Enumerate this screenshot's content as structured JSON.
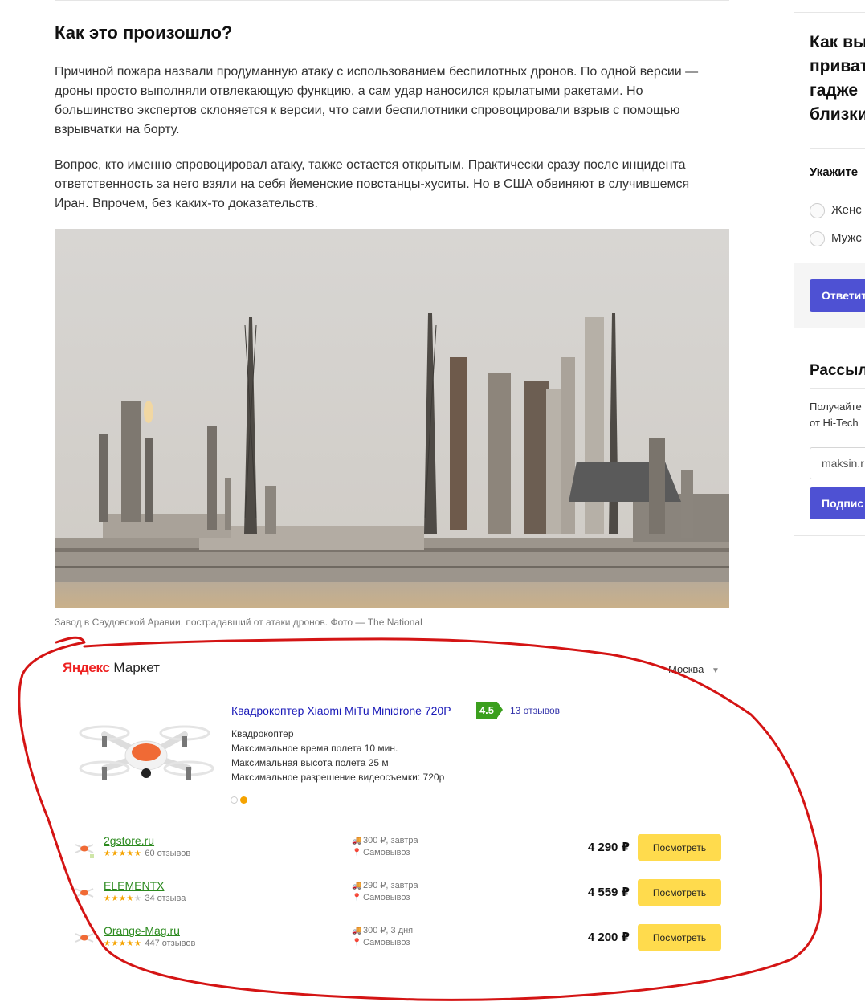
{
  "article": {
    "heading": "Как это произошло?",
    "paragraphs": [
      "Причиной пожара назвали продуманную атаку с использованием беспилотных дронов. По одной версии — дроны просто выполняли отвлекающую функцию, а сам удар наносился крылатыми ракетами. Но большинство экспертов склоняется к версии, что сами беспилотники спровоцировали взрыв с помощью взрывчатки на борту.",
      "Вопрос, кто именно спровоцировал атаку, также остается открытым. Практически сразу после инцидента ответственность за него взяли на себя йеменские повстанцы-хуситы. Но в США обвиняют в случившемся Иран. Впрочем, без каких-то доказательств."
    ],
    "photo_caption": "Завод в Саудовской Аравии, пострадавший от атаки дронов. Фото — The National"
  },
  "market": {
    "logo_yandex": "Яндекс",
    "logo_market": "Маркет",
    "region": "Москва",
    "product": {
      "title": "Квадрокоптер Xiaomi MiTu Minidrone 720P",
      "rating": "4.5",
      "reviews": "13 отзывов",
      "specs": [
        "Квадрокоптер",
        "Максимальное время полета 10 мин.",
        "Максимальная высота полета 25 м",
        "Максимальное разрешение видеосъемки: 720р"
      ]
    },
    "offers": [
      {
        "shop": "2gstore.ru",
        "stars": 5,
        "reviews": "60 отзывов",
        "delivery": "300 ₽, завтра",
        "pickup": "Самовывоз",
        "price": "4 290 ₽",
        "button": "Посмотреть"
      },
      {
        "shop": "ELEMENTX",
        "stars": 4,
        "reviews": "34 отзыва",
        "delivery": "290 ₽, завтра",
        "pickup": "Самовывоз",
        "price": "4 559 ₽",
        "button": "Посмотреть"
      },
      {
        "shop": "Orange-Mag.ru",
        "stars": 5,
        "reviews": "447 отзывов",
        "delivery": "300 ₽, 3 дня",
        "pickup": "Самовывоз",
        "price": "4 200 ₽",
        "button": "Посмотреть"
      }
    ]
  },
  "sidebar": {
    "poll": {
      "question_lines": [
        "Как вы",
        "приват",
        "гадже",
        "близки"
      ],
      "prompt": "Укажите",
      "options": [
        "Женс",
        "Мужс"
      ],
      "submit": "Ответит"
    },
    "newsletter": {
      "title": "Рассыл",
      "text_lines": [
        "Получайте",
        "от Hi-Tech"
      ],
      "email_value": "maksin.r",
      "submit": "Подпис"
    }
  },
  "icons": {
    "truck": "truck-icon",
    "pin": "map-pin-icon",
    "dropdown": "chevron-down-icon"
  },
  "colors": {
    "rating_green": "#3b9f1e",
    "button_yellow": "#ffdb4d",
    "link_blue": "#1a1ab8",
    "shop_green": "#2b8a1e",
    "accent_purple": "#4e51d3",
    "annotation_red": "#d41414"
  }
}
